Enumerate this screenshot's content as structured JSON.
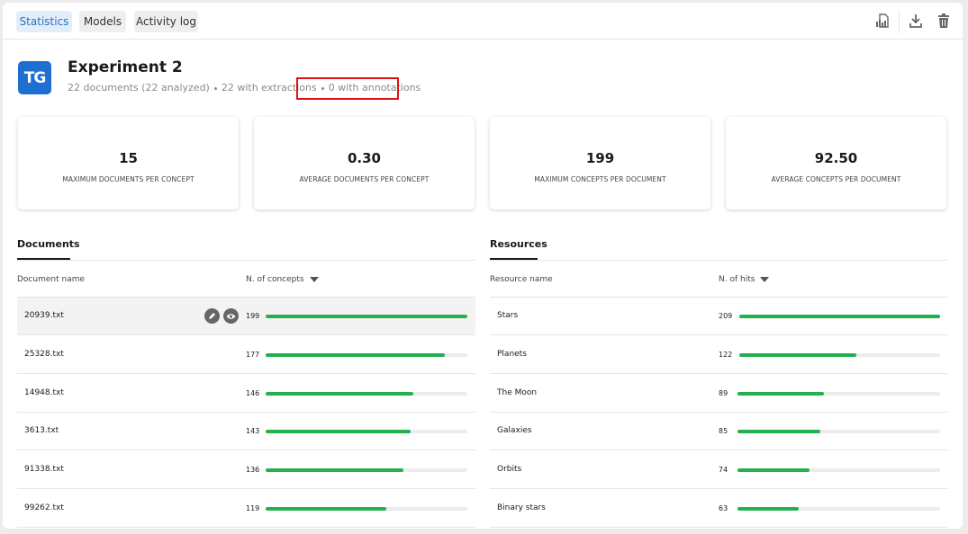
{
  "tabs": [
    {
      "label": "Statistics",
      "active": true
    },
    {
      "label": "Models",
      "active": false
    },
    {
      "label": "Activity log",
      "active": false
    }
  ],
  "toolbar_icons": [
    "report-icon",
    "download-icon",
    "trash-icon"
  ],
  "header": {
    "logo": "TG",
    "title": "Experiment 2",
    "documents": "22 documents (22 analyzed)",
    "extractions": "22 with extractions",
    "annotations": "0 with annotations"
  },
  "stats": [
    {
      "value": "15",
      "label": "MAXIMUM DOCUMENTS PER CONCEPT"
    },
    {
      "value": "0.30",
      "label": "AVERAGE DOCUMENTS PER CONCEPT"
    },
    {
      "value": "199",
      "label": "MAXIMUM CONCEPTS PER DOCUMENT"
    },
    {
      "value": "92.50",
      "label": "AVERAGE CONCEPTS PER DOCUMENT"
    }
  ],
  "documents": {
    "title": "Documents",
    "col_name": "Document name",
    "col_value": "N. of concepts",
    "max": 199,
    "rows": [
      {
        "name": "20939.txt",
        "value": "199"
      },
      {
        "name": "25328.txt",
        "value": "177"
      },
      {
        "name": "14948.txt",
        "value": "146"
      },
      {
        "name": "3613.txt",
        "value": "143"
      },
      {
        "name": "91338.txt",
        "value": "136"
      },
      {
        "name": "99262.txt",
        "value": "119"
      }
    ]
  },
  "resources": {
    "title": "Resources",
    "col_name": "Resource name",
    "col_value": "N. of hits",
    "max": 209,
    "rows": [
      {
        "name": "Stars",
        "value": "209"
      },
      {
        "name": "Planets",
        "value": "122"
      },
      {
        "name": "The Moon",
        "value": "89"
      },
      {
        "name": "Galaxies",
        "value": "85"
      },
      {
        "name": "Orbits",
        "value": "74"
      },
      {
        "name": "Binary stars",
        "value": "63"
      }
    ]
  },
  "colors": {
    "accent": "#1e6fd0",
    "bar": "#23b04f",
    "highlight_box": "#e01010"
  }
}
